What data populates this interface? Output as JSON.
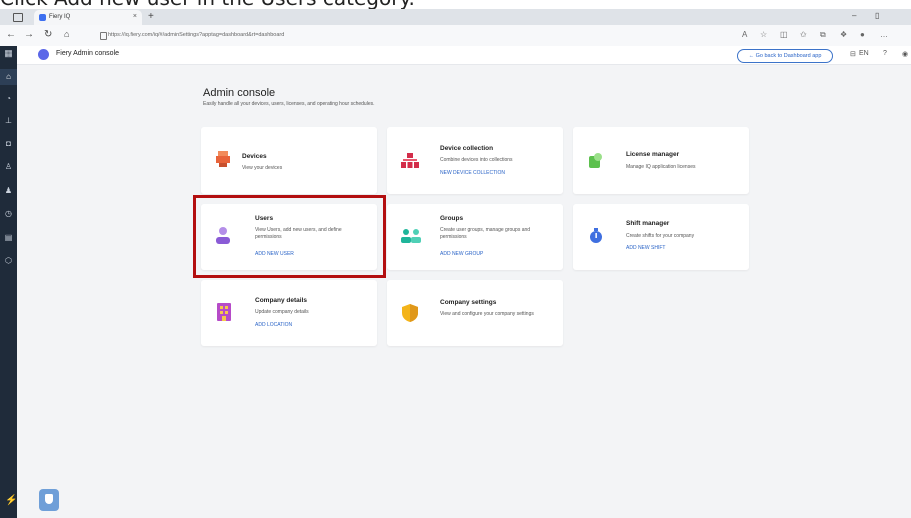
{
  "caption": "Click Add new user in the Users category.",
  "browser": {
    "tab_title": "Fiery IQ",
    "tab_close": "×",
    "new_tab": "+",
    "url": "https://iq.fiery.com/iq/#/adminSettings?apptag=dashboard&rt=dashboard",
    "minimize": "–",
    "maximize": "▯"
  },
  "app": {
    "name": "Fiery Admin console",
    "back_button": "← Go back to Dashboard app",
    "lang": "EN"
  },
  "page": {
    "title": "Admin console",
    "subtitle": "Easily handle all your devices, users, licenses, and operating hour schedules."
  },
  "cards": {
    "devices": {
      "title": "Devices",
      "desc": "View your devices",
      "link": ""
    },
    "device_collection": {
      "title": "Device collection",
      "desc": "Combine devices into collections",
      "link": "NEW DEVICE COLLECTION"
    },
    "license_manager": {
      "title": "License manager",
      "desc": "Manage IQ application licenses",
      "link": ""
    },
    "users": {
      "title": "Users",
      "desc": "View Users, add new users, and define permissions",
      "link": "ADD NEW USER"
    },
    "groups": {
      "title": "Groups",
      "desc": "Create user groups, manage groups and permissions",
      "link": "ADD NEW GROUP"
    },
    "shift_manager": {
      "title": "Shift manager",
      "desc": "Create shifts for your company",
      "link": "ADD NEW SHIFT"
    },
    "company_details": {
      "title": "Company details",
      "desc": "Update company details",
      "link": "ADD LOCATION"
    },
    "company_settings": {
      "title": "Company settings",
      "desc": "View and configure your company settings",
      "link": ""
    }
  },
  "colors": {
    "highlight": "#b30f10",
    "link": "#2a64c7",
    "rail": "#1f2b3a",
    "devices_icon": "#e8643b",
    "collection_icon": "#d32d4a",
    "license_icon": "#5cc04d",
    "users_icon": "#8a5bd6",
    "groups_icon": "#1fb59a",
    "shift_icon": "#3f6fe0",
    "company_icon": "#b64bc8",
    "settings_icon": "#f4b41a"
  }
}
